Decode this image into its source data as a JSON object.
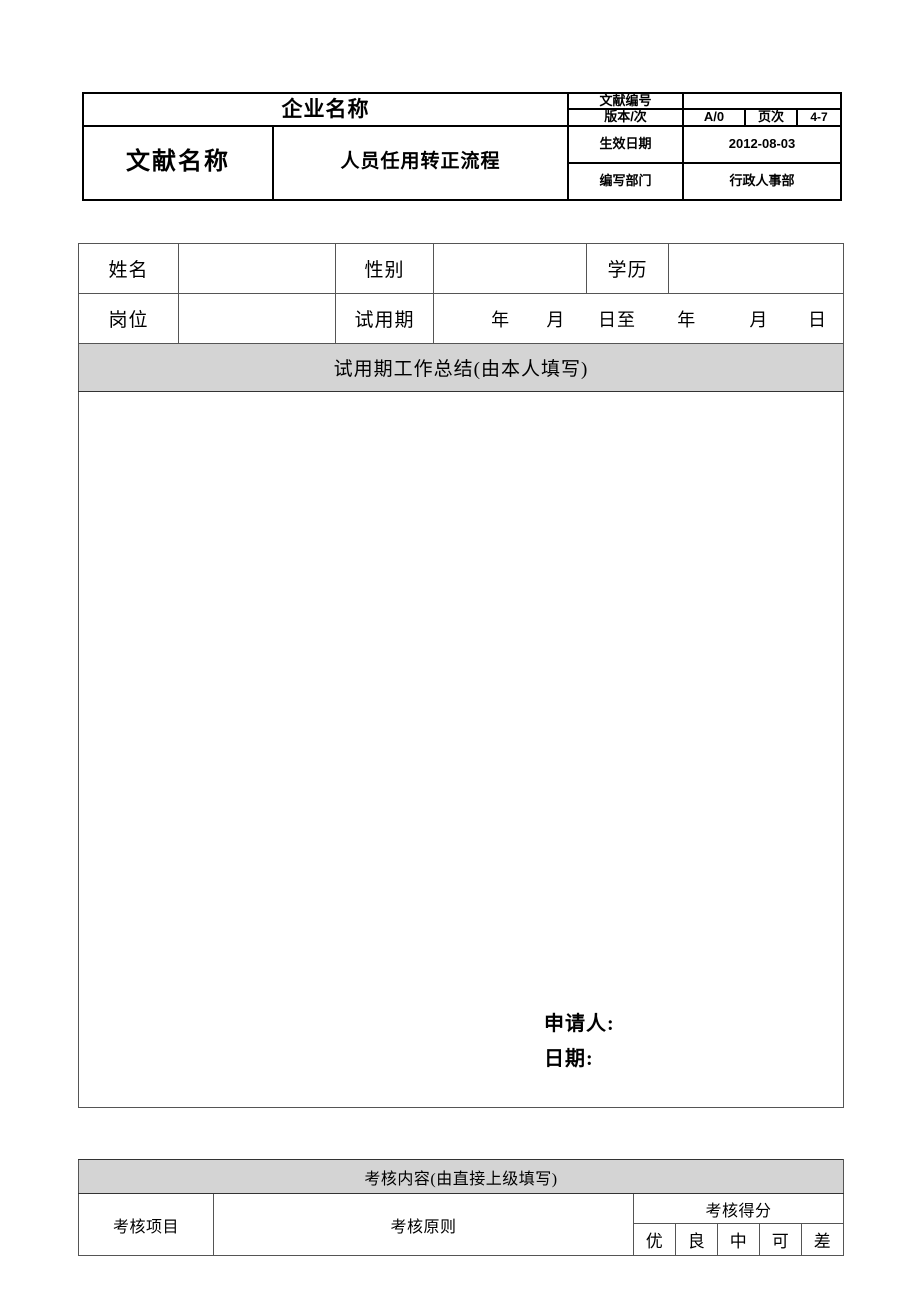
{
  "document": {
    "header": {
      "company_name": "企业名称",
      "doc_name_label": "文献名称",
      "doc_name_value": "人员任用转正流程",
      "doc_no_label": "文献编号",
      "doc_no_value": "",
      "version_label": "版本/次",
      "version_value": "A/0",
      "page_label": "页次",
      "page_value": "4-7",
      "effective_date_label": "生效日期",
      "effective_date_value": "2012-08-03",
      "dept_label": "编写部门",
      "dept_value": "行政人事部"
    },
    "info": {
      "name_label": "姓名",
      "name_value": "",
      "gender_label": "性别",
      "gender_value": "",
      "education_label": "学历",
      "education_value": "",
      "position_label": "岗位",
      "position_value": "",
      "probation_label": "试用期",
      "probation_start_year": "年",
      "probation_start_month": "月",
      "probation_start_day": "日至",
      "probation_end_year": "年",
      "probation_end_month": "月",
      "probation_end_day": "日"
    },
    "summary": {
      "band_title": "试用期工作总结(由本人填写)",
      "content": "",
      "applicant_label": "申请人:",
      "date_label": "日期:"
    },
    "assessment": {
      "band_title": "考核内容(由直接上级填写)",
      "col_item": "考核项目",
      "col_principle": "考核原则",
      "col_score": "考核得分",
      "grades": [
        "优",
        "良",
        "中",
        "可",
        "差"
      ]
    }
  },
  "colors": {
    "band_background": "#d4d4d4",
    "border": "#555555",
    "text": "#000000",
    "page_background": "#ffffff"
  }
}
